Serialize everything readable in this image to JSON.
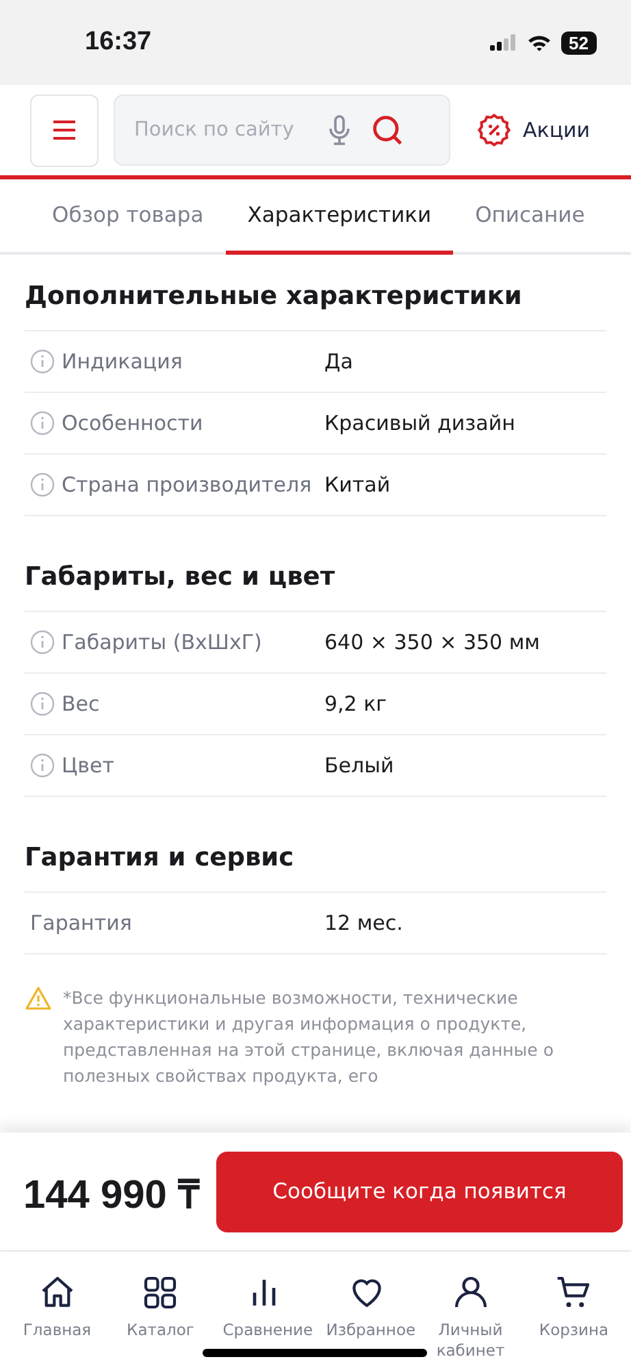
{
  "status_bar": {
    "time": "16:37",
    "battery": "52"
  },
  "header": {
    "search": {
      "placeholder": "Поиск по сайту"
    },
    "promo": "Акции"
  },
  "tabs": [
    {
      "label": "Обзор товара",
      "selected": false
    },
    {
      "label": "Характеристики",
      "selected": true
    },
    {
      "label": "Описание",
      "selected": false
    }
  ],
  "sections": [
    {
      "title": "Дополнительные характеристики",
      "rows": [
        {
          "name": "Индикация",
          "value": "Да",
          "info": true
        },
        {
          "name": "Особенности",
          "value": "Красивый дизайн",
          "info": true
        },
        {
          "name": "Страна производителя",
          "value": "Китай",
          "info": true
        }
      ]
    },
    {
      "title": "Габариты, вес и цвет",
      "rows": [
        {
          "name": "Габариты (ВхШхГ)",
          "value": "640 × 350 × 350 мм",
          "info": true
        },
        {
          "name": "Вес",
          "value": "9,2 кг",
          "info": true
        },
        {
          "name": "Цвет",
          "value": "Белый",
          "info": true
        }
      ]
    },
    {
      "title": "Гарантия и сервис",
      "rows": [
        {
          "name": "Гарантия",
          "value": "12 мес.",
          "info": false
        }
      ]
    }
  ],
  "disclaimer": "*Все функциональные возможности, технические характеристики и другая информация о продукте, представленная на этой странице, включая данные о полезных свойствах продукта, его",
  "price": "144 990 ₸",
  "notify_button": "Сообщите когда появится",
  "nav": [
    {
      "kind": "home",
      "label": "Главная",
      "selected": false
    },
    {
      "kind": "catalog",
      "label": "Каталог",
      "selected": false
    },
    {
      "kind": "compare",
      "label": "Сравнение",
      "selected": false
    },
    {
      "kind": "favorites",
      "label": "Избранное",
      "selected": false
    },
    {
      "kind": "account",
      "label": "Личный кабинет",
      "selected": false
    },
    {
      "kind": "cart",
      "label": "Корзина",
      "selected": false
    }
  ]
}
